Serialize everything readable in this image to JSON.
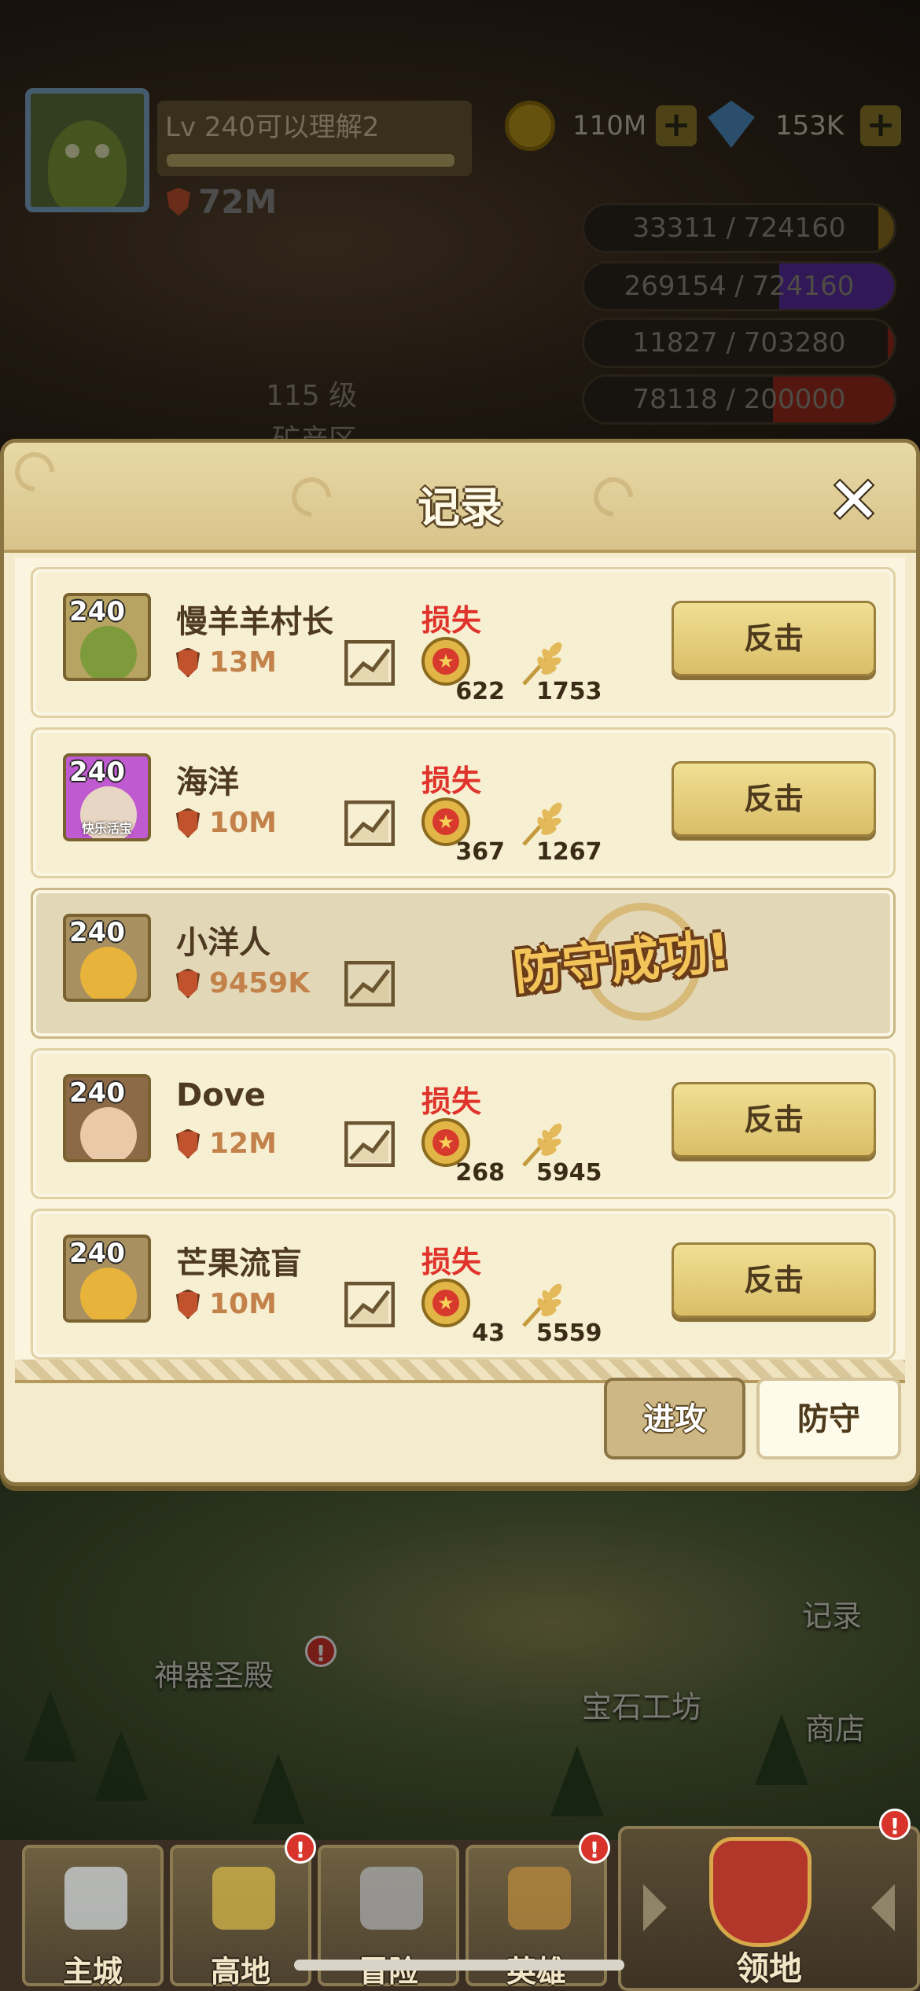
{
  "hud": {
    "player_level_name": "Lv 240可以理解2",
    "power": "72M",
    "gold": "110M",
    "gems": "153K",
    "plus": "+",
    "resources": [
      {
        "text": "33311 / 724160",
        "fill": 0.05,
        "color": "#8a6d1e",
        "icon": "wheat-icon"
      },
      {
        "text": "269154 / 724160",
        "fill": 0.37,
        "color": "#5a2ea0",
        "icon": "ore-icon"
      },
      {
        "text": "11827 / 703280",
        "fill": 0.02,
        "color": "#9a2a1e",
        "icon": "star-coin-icon"
      },
      {
        "text": "78118 / 200000",
        "fill": 0.39,
        "color": "#9a2a1e",
        "icon": "blue-token-icon"
      }
    ]
  },
  "scene": {
    "building_level": "115 级",
    "building_name": "矿产区",
    "artifact_hall": "神器圣殿",
    "gem_workshop": "宝石工坊",
    "side_records": "记录",
    "side_shop": "商店"
  },
  "dialog": {
    "title": "记录",
    "close": "✕",
    "records": [
      {
        "level": "240",
        "name": "慢羊羊村长",
        "power": "13M",
        "status": "损失",
        "coins": "622",
        "wheat": "1753",
        "action": "反击",
        "result": null
      },
      {
        "level": "240",
        "name": "海洋",
        "power": "10M",
        "status": "损失",
        "coins": "367",
        "wheat": "1267",
        "action": "反击",
        "portrait_caption": "快乐活宝",
        "result": null
      },
      {
        "level": "240",
        "name": "小洋人",
        "power": "9459K",
        "status": null,
        "coins": null,
        "wheat": null,
        "action": null,
        "result": "防守成功!"
      },
      {
        "level": "240",
        "name": "Dove",
        "power": "12M",
        "status": "损失",
        "coins": "268",
        "wheat": "5945",
        "action": "反击",
        "result": null
      },
      {
        "level": "240",
        "name": "芒果流盲",
        "power": "10M",
        "status": "损失",
        "coins": "43",
        "wheat": "5559",
        "action": "反击",
        "result": null
      }
    ],
    "tabs": {
      "attack": "进攻",
      "defend": "防守"
    }
  },
  "nav": {
    "items": [
      "主城",
      "高地",
      "冒险",
      "英雄"
    ],
    "active": "领地",
    "badge": "!"
  }
}
